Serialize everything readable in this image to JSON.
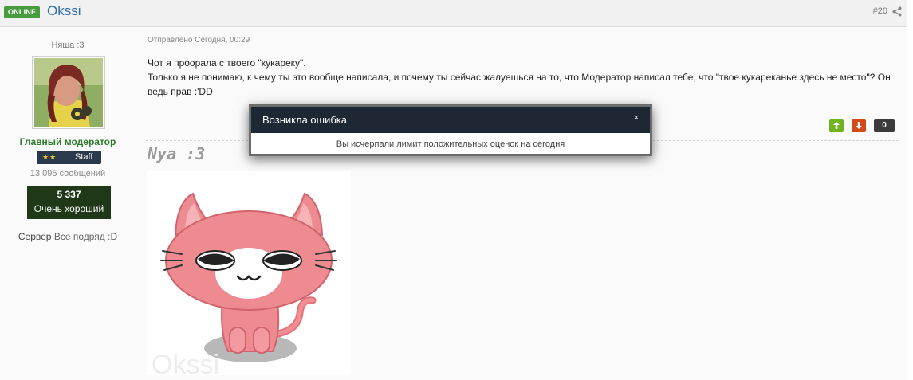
{
  "post": {
    "online_badge": "ONLINE",
    "username": "Okssi",
    "post_number": "#20",
    "share_icon": "share-icon"
  },
  "author": {
    "member_title": "Няша :3",
    "group_title": "Главный модератор",
    "staff_label": "Staff",
    "staff_stars": "★★",
    "post_count": "13 095 сообщений",
    "reputation_value": "5 337",
    "reputation_label": "Очень хороший",
    "server_label": "Сервер",
    "server_value": "Все подряд :D"
  },
  "content": {
    "date": "Отправлено Сегодня, 00:29",
    "lines": [
      "Чот я проорала с твоего \"кукареку\".",
      "Только я не понимаю, к чему ты это вообще написала, и почему ты сейчас жалуешься на то, что Модератор написал тебе, что \"твое кукареканье здесь не место\"? Он ведь прав :'DD"
    ]
  },
  "rating": {
    "up_icon": "arrow-up-icon",
    "down_icon": "arrow-down-icon",
    "count": "0"
  },
  "signature": {
    "title": "Nya :3",
    "watermark": "Okssi"
  },
  "modal": {
    "title": "Возникла ошибка",
    "close": "×",
    "message": "Вы исчерпали лимит положительных оценок на сегодня"
  },
  "colors": {
    "online_badge": "#479c3f",
    "username": "#2a6fa9",
    "group_title": "#2c7a2c",
    "reputation_box": "#1e3818",
    "rate_up": "#6fb31f",
    "rate_down": "#d34a18",
    "modal_header": "#1e2834"
  }
}
